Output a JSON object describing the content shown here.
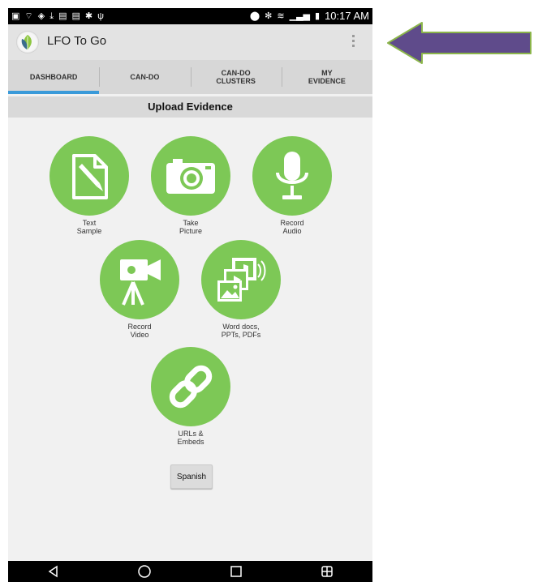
{
  "status_bar": {
    "time": "10:17 AM"
  },
  "app": {
    "title": "LFO To Go"
  },
  "tabs": [
    {
      "label": "DASHBOARD",
      "active": true
    },
    {
      "label": "CAN-DO",
      "active": false
    },
    {
      "label": "CAN-DO\nCLUSTERS",
      "active": false
    },
    {
      "label": "MY\nEVIDENCE",
      "active": false
    }
  ],
  "main": {
    "section_title": "Upload Evidence",
    "tiles": [
      {
        "label": "Text\nSample",
        "icon": "text-sample-icon"
      },
      {
        "label": "Take\nPicture",
        "icon": "camera-icon"
      },
      {
        "label": "Record\nAudio",
        "icon": "microphone-icon"
      },
      {
        "label": "Record\nVideo",
        "icon": "video-camera-icon"
      },
      {
        "label": "Word docs,\nPPTs, PDFs",
        "icon": "media-files-icon"
      },
      {
        "label": "URLs &\nEmbeds",
        "icon": "link-icon"
      }
    ],
    "language_button": "Spanish"
  },
  "colors": {
    "accent_green": "#7dc856",
    "tab_indicator": "#3a9ad9",
    "arrow_fill": "#5f4b8b",
    "arrow_stroke": "#8bb54a"
  }
}
